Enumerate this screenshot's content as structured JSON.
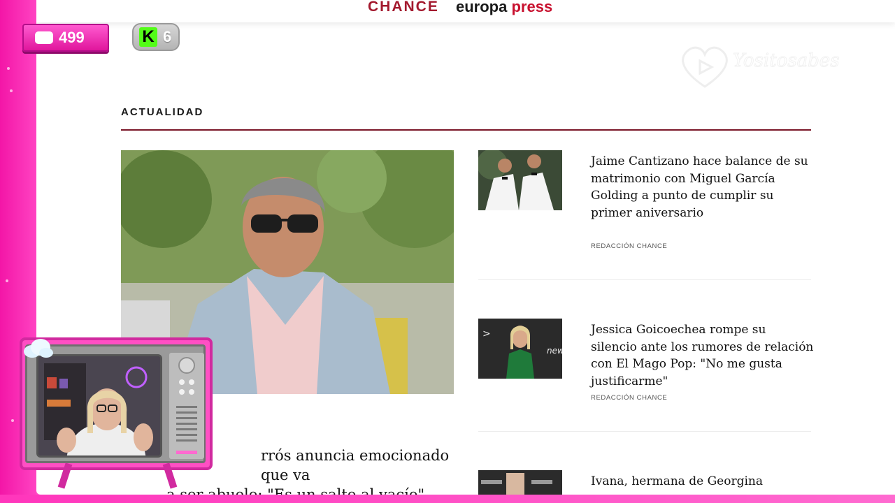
{
  "site": {
    "brand_chance": "CHANCE",
    "brand_europa": "europa",
    "brand_press": "press",
    "watermark_text": "Yositosabes"
  },
  "overlay": {
    "chat_count": "499",
    "kick_letter": "K",
    "kick_count": "6"
  },
  "section": {
    "title": "ACTUALIDAD"
  },
  "main_article": {
    "headline_line1": "rrós anuncia emocionado que va",
    "headline_line2": "a ser abuelo: \"Es un salto al vacío\""
  },
  "side_articles": [
    {
      "headline": "Jaime Cantizano hace balance de su matrimonio con Miguel García Golding a punto de cumplir su primer aniversario",
      "byline": "REDACCIÓN CHANCE"
    },
    {
      "headline": "Jessica Goicoechea rompe su silencio ante los rumores de relación con El Mago Pop: \"No me gusta justificarme\"",
      "byline": "REDACCIÓN CHANCE"
    },
    {
      "headline": "Ivana, hermana de Georgina",
      "byline": ""
    }
  ],
  "colors": {
    "brand_red": "#a3192e",
    "press_red": "#c8102e",
    "section_rule": "#7a1628",
    "stream_pink": "#ff3fbf",
    "kick_green": "#53fc18"
  }
}
